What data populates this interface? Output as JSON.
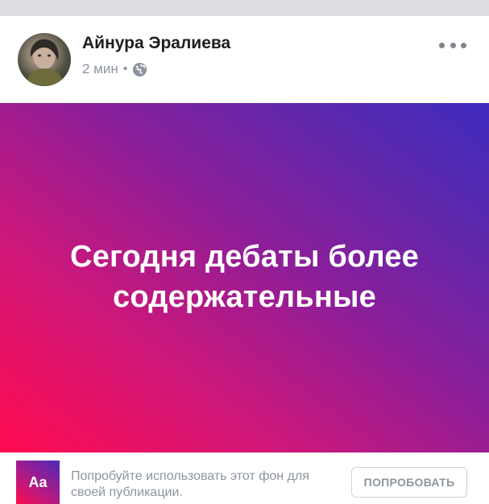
{
  "post": {
    "author_name": "Айнура Эралиева",
    "time": "2 мин",
    "separator": "•",
    "privacy_icon": "globe-icon",
    "menu_icon": "more-horizontal-icon",
    "background_text": "Сегодня дебаты более содержательные"
  },
  "promo": {
    "aa_label": "Aa",
    "text": "Попробуйте использовать этот фон для своей публикации.",
    "button_label": "ПОПРОБОВАТЬ"
  },
  "colors": {
    "gradient_start": "#ff0b4f",
    "gradient_end": "#3f2bbf",
    "author_text": "#1c1e21",
    "secondary_text": "#8d949e"
  }
}
